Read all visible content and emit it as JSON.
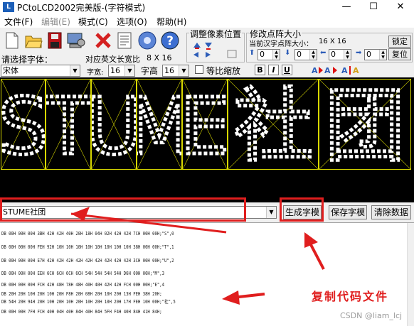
{
  "window": {
    "title": "PCtoLCD2002完美版-(字符模式)",
    "app_icon": "app-logo-icon",
    "controls": [
      "—",
      "☐",
      "✕"
    ]
  },
  "menu": [
    {
      "label": "文件(F)",
      "enabled": true
    },
    {
      "label": "编辑(E)",
      "enabled": false
    },
    {
      "label": "模式(C)",
      "enabled": true
    },
    {
      "label": "选项(O)",
      "enabled": true
    },
    {
      "label": "帮助(H)",
      "enabled": true
    }
  ],
  "toolbar_icons": [
    "new-file-icon",
    "open-folder-icon",
    "save-disk-icon",
    "settings-computer-icon",
    "delete-x-icon",
    "document-icon",
    "gear-icon",
    "help-icon"
  ],
  "pixel_adjust": {
    "title": "调整像素位置",
    "arrow_icons": [
      "shift-up-icon",
      "shift-down-icon",
      "shift-left-icon",
      "shift-right-icon",
      "shift-reset-icon"
    ]
  },
  "resize_group": {
    "title": "修改点阵大小",
    "current_label": "当前汉字点阵大小：",
    "current_value": "16 X 16",
    "confirm_button": "锁定",
    "reset_button": "复位",
    "spinners": [
      "0",
      "0",
      "0",
      "0"
    ]
  },
  "font_row": {
    "select_label": "请选择字体：",
    "ascii_label": "对应英文长宽比",
    "ascii_value": "8 X 16",
    "font_value": "宋体",
    "width_label": "字宽:",
    "width_value": "16",
    "height_label": "字高",
    "height_value": "16",
    "scale_label": "等比缩放",
    "format_buttons": [
      "B",
      "I",
      "U"
    ]
  },
  "glyph_row": {
    "characters": [
      "S",
      "T",
      "U",
      "M",
      "E",
      "社",
      "团"
    ],
    "colors": {
      "background": "#000000",
      "grid": "#d8d800",
      "dot": "#ffffff"
    }
  },
  "input_row": {
    "text_value": "STUME社团",
    "generate_button": "生成字模",
    "save_button": "保存字模",
    "clear_button": "清除数据"
  },
  "output_lines": [
    "DB 00H 00H 00H 3BH 42H 42H 40H 20H 18H 04H 02H 42H 42H 7CH 00H 00H;\"S\",0",
    "DB 00H 00H 00H FEH 92H 10H 10H 10H 10H 10H 10H 10H 10H 38H 00H 00H;\"T\",1",
    "DB 00H 00H 00H E7H 42H 42H 42H 42H 42H 42H 42H 42H 42H 3CH 00H 00H;\"U\",2",
    "DB 00H 00H 00H EEH 6CH 6CH 6CH 6CH 54H 54H 54H 54H D6H 00H 00H;\"M\",3",
    "DB 00H 00H 00H FCH 42H 48H 78H 48H 40H 40H 42H 42H FCH 00H 00H;\"E\",4",
    "DB 20H 20H 10H 20H 10H 20H F8H 20H 08H 20H 10H 20H 13H FEH 38H 20H;",
    "DB 54H 20H 94H 20H 10H 20H 10H 20H 10H 20H 10H 20H 17H FEH 10H 00H;\"社\",5",
    "DB 00H 00H 7FH FCH 40H 04H 40H 84H 40H 84H 5FH F4H 40H 84H 41H 84H;"
  ],
  "annotation": {
    "text": "复制代码文件",
    "color": "#e01e1e"
  },
  "watermark": "CSDN @liam_lcj"
}
